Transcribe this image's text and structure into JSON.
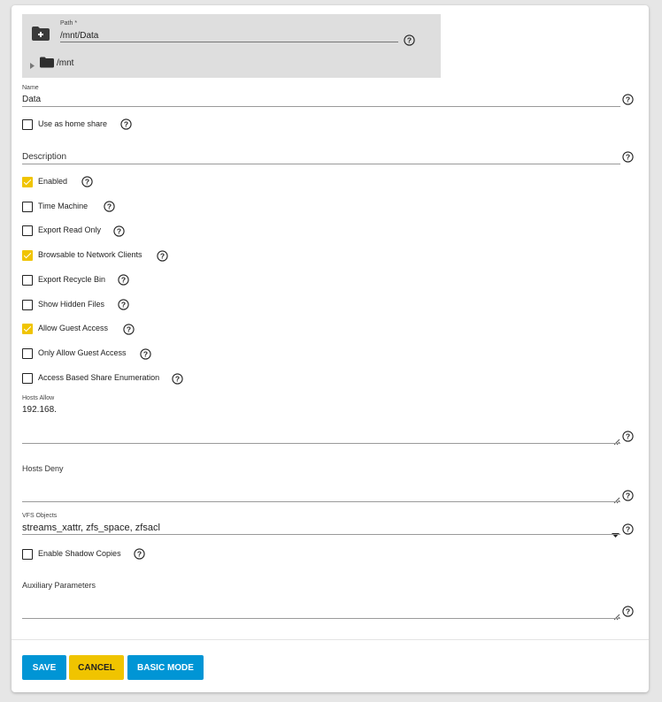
{
  "explorer": {
    "path_label": "Path *",
    "path_value": "/mnt/Data",
    "tree_root": "/mnt"
  },
  "name": {
    "label": "Name",
    "value": "Data"
  },
  "home_share": {
    "label": "Use as home share",
    "checked": false
  },
  "description": {
    "placeholder": "Description"
  },
  "checkboxes": [
    {
      "label": "Enabled",
      "checked": true
    },
    {
      "label": "Time Machine",
      "checked": false
    },
    {
      "label": "Export Read Only",
      "checked": false
    },
    {
      "label": "Browsable to Network Clients",
      "checked": true
    },
    {
      "label": "Export Recycle Bin",
      "checked": false
    },
    {
      "label": "Show Hidden Files",
      "checked": false
    },
    {
      "label": "Allow Guest Access",
      "checked": true
    },
    {
      "label": "Only Allow Guest Access",
      "checked": false
    },
    {
      "label": "Access Based Share Enumeration",
      "checked": false
    }
  ],
  "hosts_allow": {
    "label": "Hosts Allow",
    "value": "192.168."
  },
  "hosts_deny": {
    "placeholder": "Hosts Deny"
  },
  "vfs_objects": {
    "label": "VFS Objects",
    "value": "streams_xattr, zfs_space, zfsacl"
  },
  "shadow_copies": {
    "label": "Enable Shadow Copies",
    "checked": false
  },
  "aux_params": {
    "placeholder": "Auxiliary Parameters"
  },
  "buttons": {
    "save": "SAVE",
    "cancel": "CANCEL",
    "basic_mode": "BASIC MODE"
  },
  "colors": {
    "primary": "#0095d5",
    "accent": "#f0c400",
    "background": "#e6e6e6"
  },
  "icons": [
    "folder-add-icon",
    "help-icon",
    "folder-icon",
    "caret-right-icon",
    "dropdown-caret-icon",
    "resize-handle-icon",
    "checkmark-icon"
  ]
}
